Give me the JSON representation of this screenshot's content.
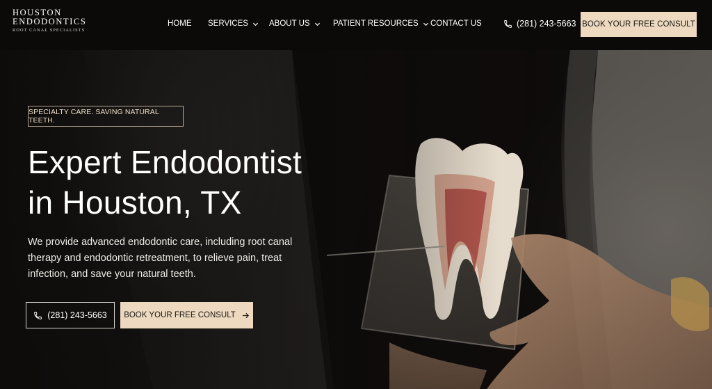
{
  "logo": {
    "line1": "HOUSTON",
    "line2": "ENDODONTICS",
    "line3": "ROOT CANAL SPECIALISTS"
  },
  "nav": {
    "items": [
      {
        "label": "HOME",
        "dropdown": false
      },
      {
        "label": "SERVICES",
        "dropdown": true
      },
      {
        "label": "ABOUT US",
        "dropdown": true
      },
      {
        "label": "PATIENT RESOURCES",
        "dropdown": true
      },
      {
        "label": "CONTACT US",
        "dropdown": false
      }
    ],
    "phone": "(281) 243-5663",
    "cta": "BOOK YOUR FREE CONSULT"
  },
  "hero": {
    "tagline": "SPECIALTY CARE. SAVING NATURAL TEETH.",
    "headline_line1": "Expert Endodontist",
    "headline_line2": "in Houston, TX",
    "body": "We provide advanced endodontic care, including root canal therapy and endodontic retreatment, to relieve pain, treat infection, and save your natural teeth.",
    "phone_button": "(281) 243-5663",
    "consult_button": "BOOK YOUR FREE CONSULT"
  },
  "colors": {
    "accent": "#ecd9bf",
    "header_bg": "#0b0a09",
    "text_dark": "#1b1814"
  },
  "icons": {
    "phone": "phone-icon",
    "chevron": "chevron-down-icon",
    "arrow": "arrow-right-icon"
  }
}
